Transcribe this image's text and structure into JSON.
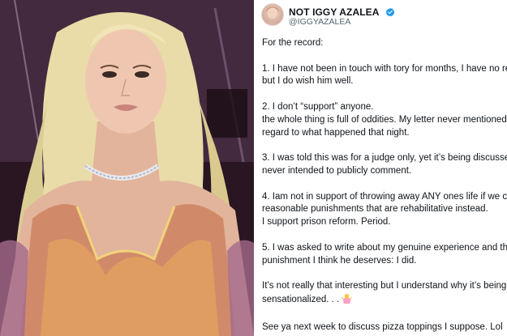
{
  "tweet": {
    "display_name": "NOT IGGY AZALEA",
    "handle": "@IGGYAZALEA",
    "verified_icon": "verified-badge-icon",
    "lines": [
      "For the record:",
      "",
      "1. I have not been in touch with tory for months, I have no re",
      "but I do wish him well.",
      "",
      "2. I don’t “support” anyone.",
      "the whole thing is full of oddities. My letter never mentioned",
      "regard to what  happened that night.",
      "",
      "3. I was told this was for a judge only, yet it’s being discusse",
      "never intended to publicly comment.",
      "",
      "4. Iam not in support of throwing away ANY ones life if we c",
      "reasonable punishments that are rehabilitative instead.",
      "I support prison reform. Period.",
      "",
      "5. I was asked to write about my genuine experience and th",
      "punishment I think he deserves: I did.",
      "",
      "It’s not really that interesting but I understand why it’s being",
      "sensationalized. . .",
      "",
      "See ya next week to discuss pizza toppings I suppose. Lol"
    ],
    "emoji_icon": "person-shrugging-emoji-icon"
  },
  "photo": {
    "subject": "performer-photo"
  },
  "colors": {
    "verified_blue": "#1d9bf0",
    "text": "#0f1419",
    "secondary_text": "#536471"
  }
}
